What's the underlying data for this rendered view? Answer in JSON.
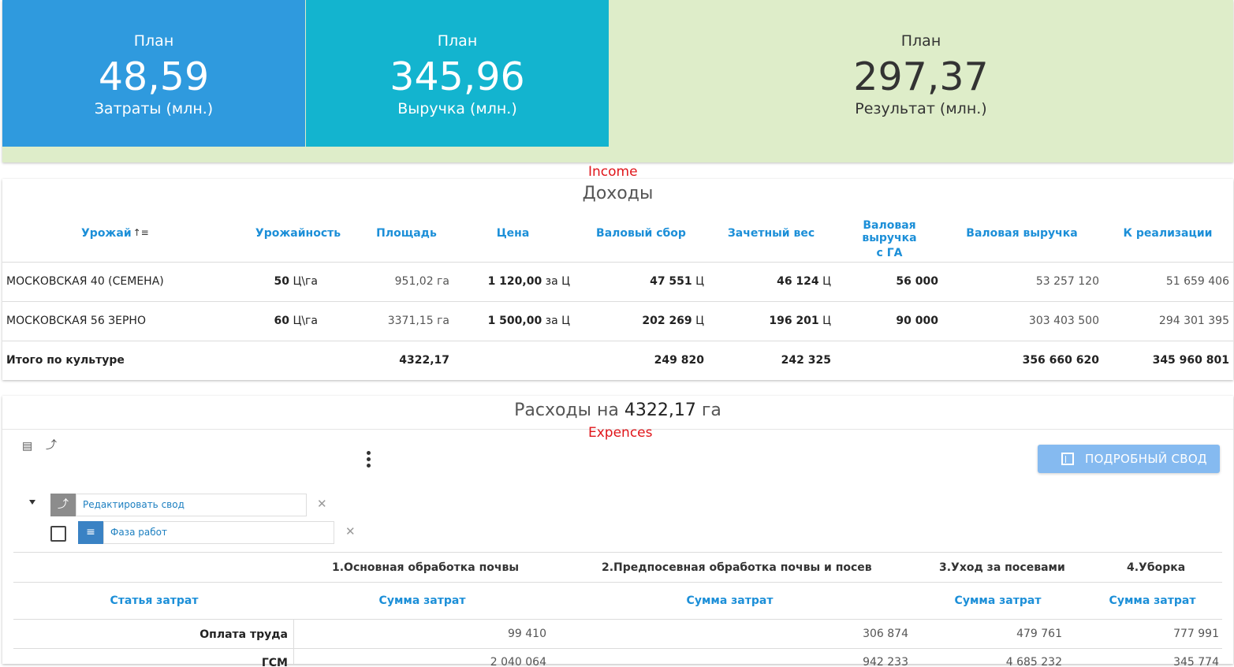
{
  "kpis": [
    {
      "label": "План",
      "value": "48,59",
      "sub": "Затраты (млн.)"
    },
    {
      "label": "План",
      "value": "345,96",
      "sub": "Выручка (млн.)"
    },
    {
      "label": "План",
      "value": "297,37",
      "sub": "Результат (млн.)"
    }
  ],
  "annotations": {
    "income": "Income",
    "expenses": "Expences"
  },
  "income": {
    "title": "Доходы",
    "sort_icon": "sort-ascending-icon",
    "headers": {
      "crop": "Урожай",
      "yield": "Урожайность",
      "area": "Площадь",
      "price": "Цена",
      "gross_harvest": "Валовый сбор",
      "credit_weight": "Зачетный вес",
      "gross_rev_ha_1": "Валовая выручка",
      "gross_rev_ha_2": "с ГА",
      "gross_rev": "Валовая выручка",
      "for_sale": "К реализации"
    },
    "rows": [
      {
        "crop": "МОСКОВСКАЯ 40 (СЕМЕНА)",
        "yield": "50",
        "yield_unit": "Ц\\га",
        "area": "951,02 га",
        "price": "1 120,00",
        "price_unit": "за Ц",
        "gross_harvest": "47 551",
        "gross_harvest_unit": "Ц",
        "credit_weight": "46 124",
        "credit_weight_unit": "Ц",
        "gross_rev_ha": "56 000",
        "gross_rev": "53 257 120",
        "for_sale": "51 659 406"
      },
      {
        "crop": "МОСКОВСКАЯ 56 ЗЕРНО",
        "yield": "60",
        "yield_unit": "Ц\\га",
        "area": "3371,15 га",
        "price": "1 500,00",
        "price_unit": "за Ц",
        "gross_harvest": "202 269",
        "gross_harvest_unit": "Ц",
        "credit_weight": "196 201",
        "credit_weight_unit": "Ц",
        "gross_rev_ha": "90 000",
        "gross_rev": "303 403 500",
        "for_sale": "294 301 395"
      }
    ],
    "total": {
      "label": "Итого по культуре",
      "area": "4322,17",
      "gross_harvest": "249 820",
      "credit_weight": "242 325",
      "gross_rev": "356 660 620",
      "for_sale": "345 960 801"
    }
  },
  "expenses": {
    "title_prefix": "Расходы на",
    "title_value": "4322,17",
    "title_suffix": "га",
    "detail_button": "ПОДРОБНЫЙ СВОД",
    "chips": [
      {
        "label": "Редактировать свод",
        "icon": "edit-pivot-icon"
      },
      {
        "label": "Фаза работ",
        "icon": "list-icon"
      }
    ],
    "phases": [
      "1.Основная обработка почвы",
      "2.Предпосевная обработка почвы и посев",
      "3.Уход за посевами",
      "4.Уборка"
    ],
    "col_header": "Статья затрат",
    "sum_header": "Сумма затрат",
    "rows": [
      {
        "label": "Оплата труда",
        "values": [
          "99 410",
          "306 874",
          "479 761",
          "777 991"
        ]
      },
      {
        "label": "ГСМ",
        "values": [
          "2 040 064",
          "942 233",
          "4 685 232",
          "345 774"
        ]
      }
    ]
  }
}
